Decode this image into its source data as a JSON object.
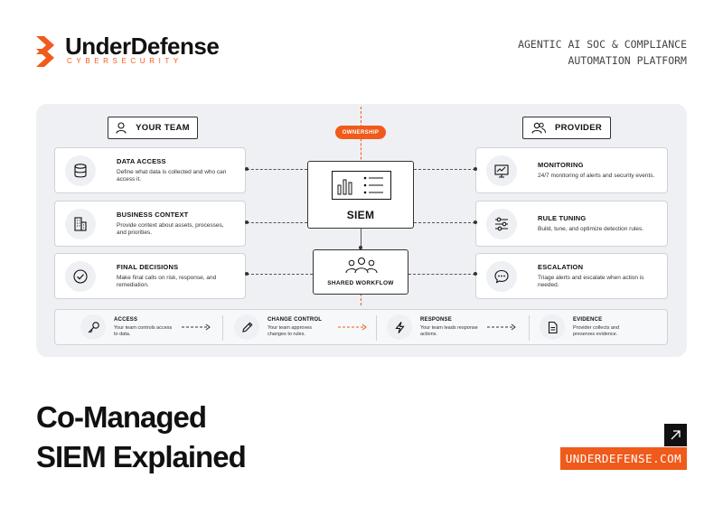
{
  "brand": {
    "name": "UnderDefense",
    "sub": "CYBERSECURITY",
    "tagline_line1": "AGENTIC AI SOC & COMPLIANCE",
    "tagline_line2": "AUTOMATION PLATFORM",
    "accent_color": "#f05a1a"
  },
  "diagram": {
    "your_team_label": "YOUR TEAM",
    "provider_label": "PROVIDER",
    "ownership_label": "OWNERSHIP",
    "siem_label": "SIEM",
    "workflow_label": "SHARED WORKFLOW",
    "team_cards": [
      {
        "icon": "database-icon",
        "title": "DATA ACCESS",
        "desc": "Define what data is collected and who can access it."
      },
      {
        "icon": "building-icon",
        "title": "BUSINESS CONTEXT",
        "desc": "Provide context about assets, processes, and priorities."
      },
      {
        "icon": "check-circle-icon",
        "title": "FINAL DECISIONS",
        "desc": "Make final calls on risk, response, and remediation."
      }
    ],
    "provider_cards": [
      {
        "icon": "monitor-chart-icon",
        "title": "MONITORING",
        "desc": "24/7 monitoring of alerts and security events."
      },
      {
        "icon": "sliders-icon",
        "title": "RULE TUNING",
        "desc": "Build, tune, and optimize detection rules."
      },
      {
        "icon": "chat-bubble-icon",
        "title": "ESCALATION",
        "desc": "Triage alerts and escalate when action is needed."
      }
    ],
    "flow": [
      {
        "icon": "key-icon",
        "title": "ACCESS",
        "desc": "Your team controls access to data."
      },
      {
        "icon": "pencil-icon",
        "title": "CHANGE CONTROL",
        "desc": "Your team approves changes to rules."
      },
      {
        "icon": "lightning-icon",
        "title": "RESPONSE",
        "desc": "Your team leads response actions."
      },
      {
        "icon": "document-icon",
        "title": "EVIDENCE",
        "desc": "Provider collects and preserves evidence."
      }
    ]
  },
  "footer": {
    "headline_line1": "Co-Managed",
    "headline_line2": "SIEM Explained",
    "url": "UNDERDEFENSE.COM"
  }
}
